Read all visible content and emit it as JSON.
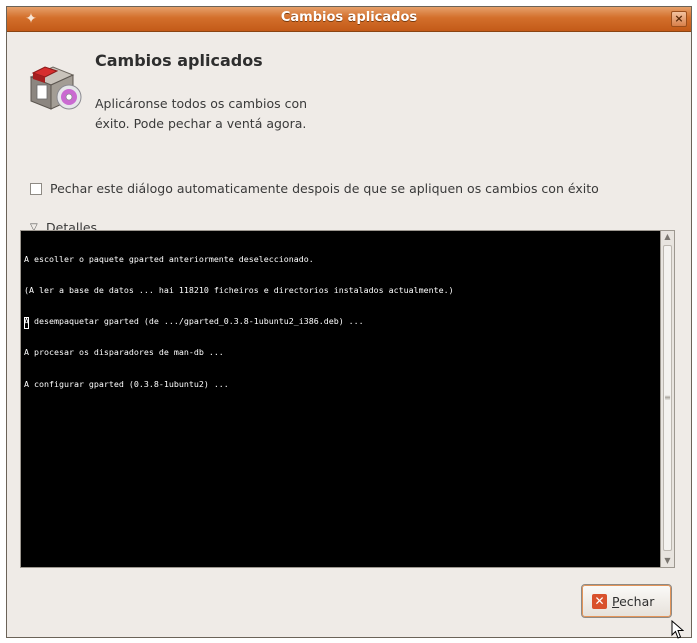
{
  "window": {
    "title": "Cambios aplicados",
    "close_glyph": "×"
  },
  "dialog": {
    "heading": "Cambios aplicados",
    "message": "Aplicáronse todos os cambios con éxito. Pode pechar a ventá agora.",
    "icon": "package-manager-icon"
  },
  "options": {
    "auto_close_label": "Pechar este diálogo automaticamente despois de que se apliquen os cambios con éxito",
    "auto_close_checked": false
  },
  "details": {
    "label": "Detalles",
    "expanded": true,
    "lines": [
      "A escoller o paquete gparted anteriormente deseleccionado.",
      "(A ler a base de datos ... hai 118210 ficheiros e directorios instalados actualmente.)",
      "A desempaquetar gparted (de .../gparted_0.3.8-1ubuntu2_i386.deb) ...",
      "A procesar os disparadores de man-db ...",
      "A configurar gparted (0.3.8-1ubuntu2) ..."
    ]
  },
  "buttons": {
    "close_label": "Pechar",
    "close_label_mnemonic": "P",
    "close_label_rest": "echar"
  },
  "colors": {
    "titlebar": "#d36f2b",
    "terminal_bg": "#000000",
    "terminal_fg": "#ffffff",
    "window_bg": "#efebe7"
  }
}
